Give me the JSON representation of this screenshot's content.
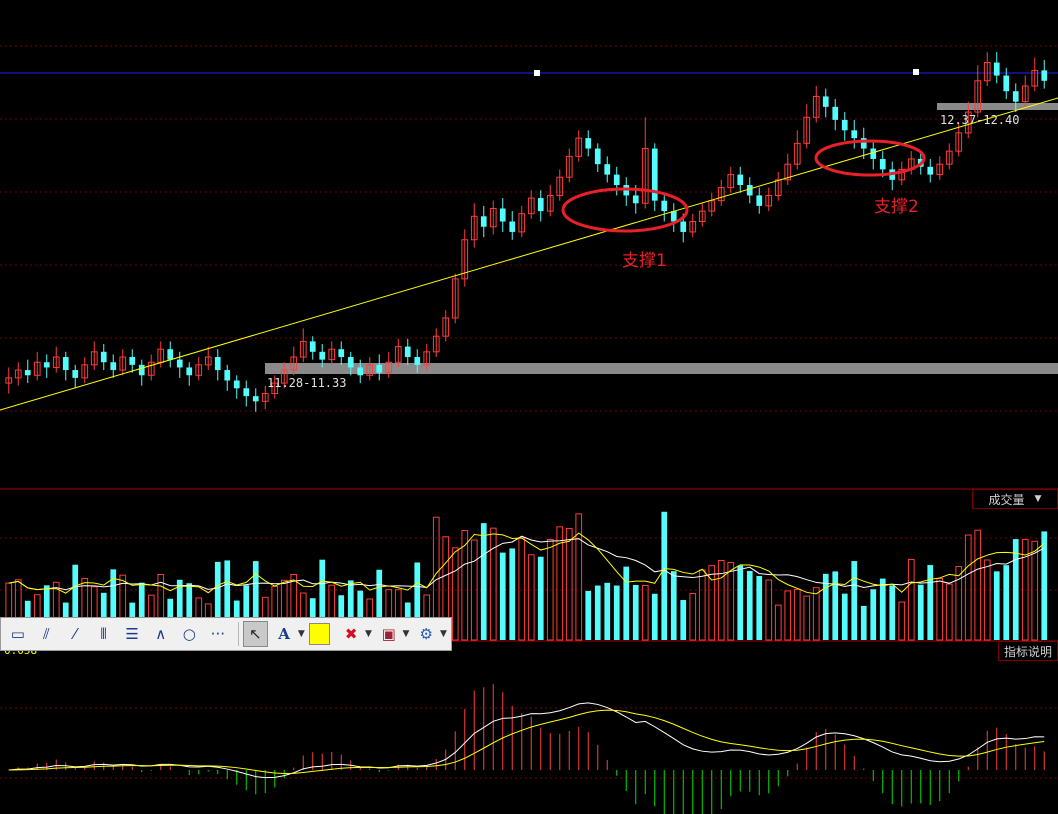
{
  "colors": {
    "up": "#ff3c3c",
    "down": "#54fcfc",
    "grid": "#7a0000",
    "support_line": "#ffff00",
    "blue_line": "#2020ff",
    "zone": "#8a8a8a",
    "annotation": "#e8202a",
    "ma_white": "#ffffff",
    "ma_yellow": "#ffff00",
    "macd_pos": "#ff3c3c",
    "macd_neg": "#00e000"
  },
  "annotations": {
    "support1": "支撑1",
    "support2": "支撑2",
    "zone_low": "11.28-11.33",
    "zone_high": "12.37-12.40"
  },
  "volume_panel": {
    "indicator_label": "成交量"
  },
  "macd_panel": {
    "value_label": "0.058",
    "indicator_button": "指标说明"
  },
  "toolbar": {
    "icons": [
      "rect-icon",
      "fan-icon",
      "parallel-icon",
      "vertical-lines-icon",
      "fibonacci-icon",
      "wave-icon",
      "ellipse-icon",
      "more-icon"
    ],
    "cursor_icon": "cursor-icon",
    "text_icon": "A",
    "color_swatch": "#ffff00",
    "delete_icon": "✖",
    "settings_icon": "⚙"
  },
  "chart_data": {
    "type": "candlestick",
    "price_zones": [
      {
        "label": "11.28-11.33",
        "low": 11.28,
        "high": 11.33
      },
      {
        "label": "12.37-12.40",
        "low": 12.37,
        "high": 12.4
      }
    ],
    "candles_approx": [
      [
        11.28,
        11.3,
        11.24,
        11.34
      ],
      [
        11.3,
        11.33,
        11.27,
        11.36
      ],
      [
        11.33,
        11.31,
        11.28,
        11.37
      ],
      [
        11.31,
        11.36,
        11.29,
        11.4
      ],
      [
        11.36,
        11.34,
        11.3,
        11.39
      ],
      [
        11.34,
        11.38,
        11.32,
        11.42
      ],
      [
        11.38,
        11.33,
        11.29,
        11.4
      ],
      [
        11.33,
        11.3,
        11.26,
        11.35
      ],
      [
        11.3,
        11.35,
        11.28,
        11.38
      ],
      [
        11.35,
        11.4,
        11.33,
        11.44
      ],
      [
        11.4,
        11.36,
        11.33,
        11.43
      ],
      [
        11.36,
        11.33,
        11.3,
        11.39
      ],
      [
        11.33,
        11.38,
        11.31,
        11.41
      ],
      [
        11.38,
        11.35,
        11.32,
        11.41
      ],
      [
        11.35,
        11.31,
        11.27,
        11.37
      ],
      [
        11.31,
        11.36,
        11.29,
        11.39
      ],
      [
        11.36,
        11.41,
        11.34,
        11.44
      ],
      [
        11.41,
        11.37,
        11.34,
        11.44
      ],
      [
        11.37,
        11.34,
        11.3,
        11.4
      ],
      [
        11.34,
        11.31,
        11.27,
        11.36
      ],
      [
        11.31,
        11.35,
        11.29,
        11.38
      ],
      [
        11.35,
        11.38,
        11.33,
        11.42
      ],
      [
        11.38,
        11.33,
        11.29,
        11.41
      ],
      [
        11.33,
        11.29,
        11.25,
        11.35
      ],
      [
        11.29,
        11.26,
        11.22,
        11.31
      ],
      [
        11.26,
        11.23,
        11.19,
        11.29
      ],
      [
        11.23,
        11.21,
        11.17,
        11.26
      ],
      [
        11.21,
        11.24,
        11.18,
        11.27
      ],
      [
        11.24,
        11.28,
        11.22,
        11.31
      ],
      [
        11.28,
        11.33,
        11.26,
        11.36
      ],
      [
        11.33,
        11.38,
        11.31,
        11.42
      ],
      [
        11.38,
        11.44,
        11.36,
        11.49
      ],
      [
        11.44,
        11.4,
        11.37,
        11.46
      ],
      [
        11.4,
        11.37,
        11.34,
        11.43
      ],
      [
        11.37,
        11.41,
        11.35,
        11.44
      ],
      [
        11.41,
        11.38,
        11.35,
        11.44
      ],
      [
        11.38,
        11.34,
        11.31,
        11.4
      ],
      [
        11.34,
        11.31,
        11.28,
        11.37
      ],
      [
        11.31,
        11.35,
        11.29,
        11.38
      ],
      [
        11.35,
        11.32,
        11.29,
        11.39
      ],
      [
        11.32,
        11.36,
        11.3,
        11.4
      ],
      [
        11.36,
        11.42,
        11.34,
        11.45
      ],
      [
        11.42,
        11.38,
        11.35,
        11.45
      ],
      [
        11.38,
        11.35,
        11.32,
        11.41
      ],
      [
        11.35,
        11.4,
        11.33,
        11.43
      ],
      [
        11.4,
        11.46,
        11.38,
        11.49
      ],
      [
        11.46,
        11.53,
        11.44,
        11.56
      ],
      [
        11.53,
        11.68,
        11.51,
        11.7
      ],
      [
        11.68,
        11.83,
        11.65,
        11.87
      ],
      [
        11.83,
        11.92,
        11.8,
        11.97
      ],
      [
        11.92,
        11.88,
        11.84,
        11.96
      ],
      [
        11.88,
        11.95,
        11.85,
        11.98
      ],
      [
        11.95,
        11.9,
        11.86,
        11.99
      ],
      [
        11.9,
        11.86,
        11.83,
        11.94
      ],
      [
        11.86,
        11.93,
        11.84,
        11.96
      ],
      [
        11.93,
        11.99,
        11.91,
        12.02
      ],
      [
        11.99,
        11.94,
        11.9,
        12.02
      ],
      [
        11.94,
        12.0,
        11.92,
        12.04
      ],
      [
        12.0,
        12.07,
        11.98,
        12.1
      ],
      [
        12.07,
        12.15,
        12.05,
        12.18
      ],
      [
        12.15,
        12.22,
        12.13,
        12.25
      ],
      [
        12.22,
        12.18,
        12.15,
        12.25
      ],
      [
        12.18,
        12.12,
        12.09,
        12.2
      ],
      [
        12.12,
        12.08,
        12.05,
        12.15
      ],
      [
        12.08,
        12.04,
        12.0,
        12.11
      ],
      [
        12.04,
        12.0,
        11.96,
        12.07
      ],
      [
        12.0,
        11.97,
        11.93,
        12.04
      ],
      [
        11.97,
        12.18,
        11.95,
        12.3
      ],
      [
        12.18,
        11.98,
        11.94,
        12.2
      ],
      [
        11.98,
        11.94,
        11.9,
        12.0
      ],
      [
        11.94,
        11.9,
        11.86,
        11.97
      ],
      [
        11.9,
        11.86,
        11.82,
        11.93
      ],
      [
        11.86,
        11.9,
        11.84,
        11.93
      ],
      [
        11.9,
        11.94,
        11.88,
        11.97
      ],
      [
        11.94,
        11.98,
        11.92,
        12.01
      ],
      [
        11.98,
        12.03,
        11.96,
        12.06
      ],
      [
        12.03,
        12.08,
        12.01,
        12.11
      ],
      [
        12.08,
        12.04,
        12.01,
        12.11
      ],
      [
        12.04,
        12.0,
        11.97,
        12.07
      ],
      [
        12.0,
        11.96,
        11.93,
        12.03
      ],
      [
        11.96,
        12.0,
        11.94,
        12.03
      ],
      [
        12.0,
        12.06,
        11.98,
        12.09
      ],
      [
        12.06,
        12.12,
        12.04,
        12.16
      ],
      [
        12.12,
        12.2,
        12.1,
        12.25
      ],
      [
        12.2,
        12.3,
        12.18,
        12.35
      ],
      [
        12.3,
        12.38,
        12.28,
        12.42
      ],
      [
        12.38,
        12.34,
        12.3,
        12.41
      ],
      [
        12.34,
        12.29,
        12.25,
        12.37
      ],
      [
        12.29,
        12.25,
        12.21,
        12.32
      ],
      [
        12.25,
        12.22,
        12.18,
        12.29
      ],
      [
        12.22,
        12.18,
        12.14,
        12.26
      ],
      [
        12.18,
        12.14,
        12.1,
        12.21
      ],
      [
        12.14,
        12.1,
        12.07,
        12.17
      ],
      [
        12.1,
        12.06,
        12.02,
        12.13
      ],
      [
        12.06,
        12.1,
        12.04,
        12.13
      ],
      [
        12.1,
        12.14,
        12.08,
        12.17
      ],
      [
        12.14,
        12.11,
        12.08,
        12.17
      ],
      [
        12.11,
        12.08,
        12.05,
        12.14
      ],
      [
        12.08,
        12.12,
        12.06,
        12.15
      ],
      [
        12.12,
        12.17,
        12.1,
        12.2
      ],
      [
        12.17,
        12.24,
        12.15,
        12.28
      ],
      [
        12.24,
        12.32,
        12.22,
        12.36
      ],
      [
        12.32,
        12.44,
        12.3,
        12.5
      ],
      [
        12.44,
        12.51,
        12.42,
        12.55
      ],
      [
        12.51,
        12.46,
        12.43,
        12.55
      ],
      [
        12.46,
        12.4,
        12.37,
        12.49
      ],
      [
        12.4,
        12.36,
        12.32,
        12.43
      ],
      [
        12.36,
        12.42,
        12.34,
        12.46
      ],
      [
        12.42,
        12.48,
        12.4,
        12.53
      ],
      [
        12.48,
        12.44,
        12.41,
        12.52
      ]
    ]
  }
}
